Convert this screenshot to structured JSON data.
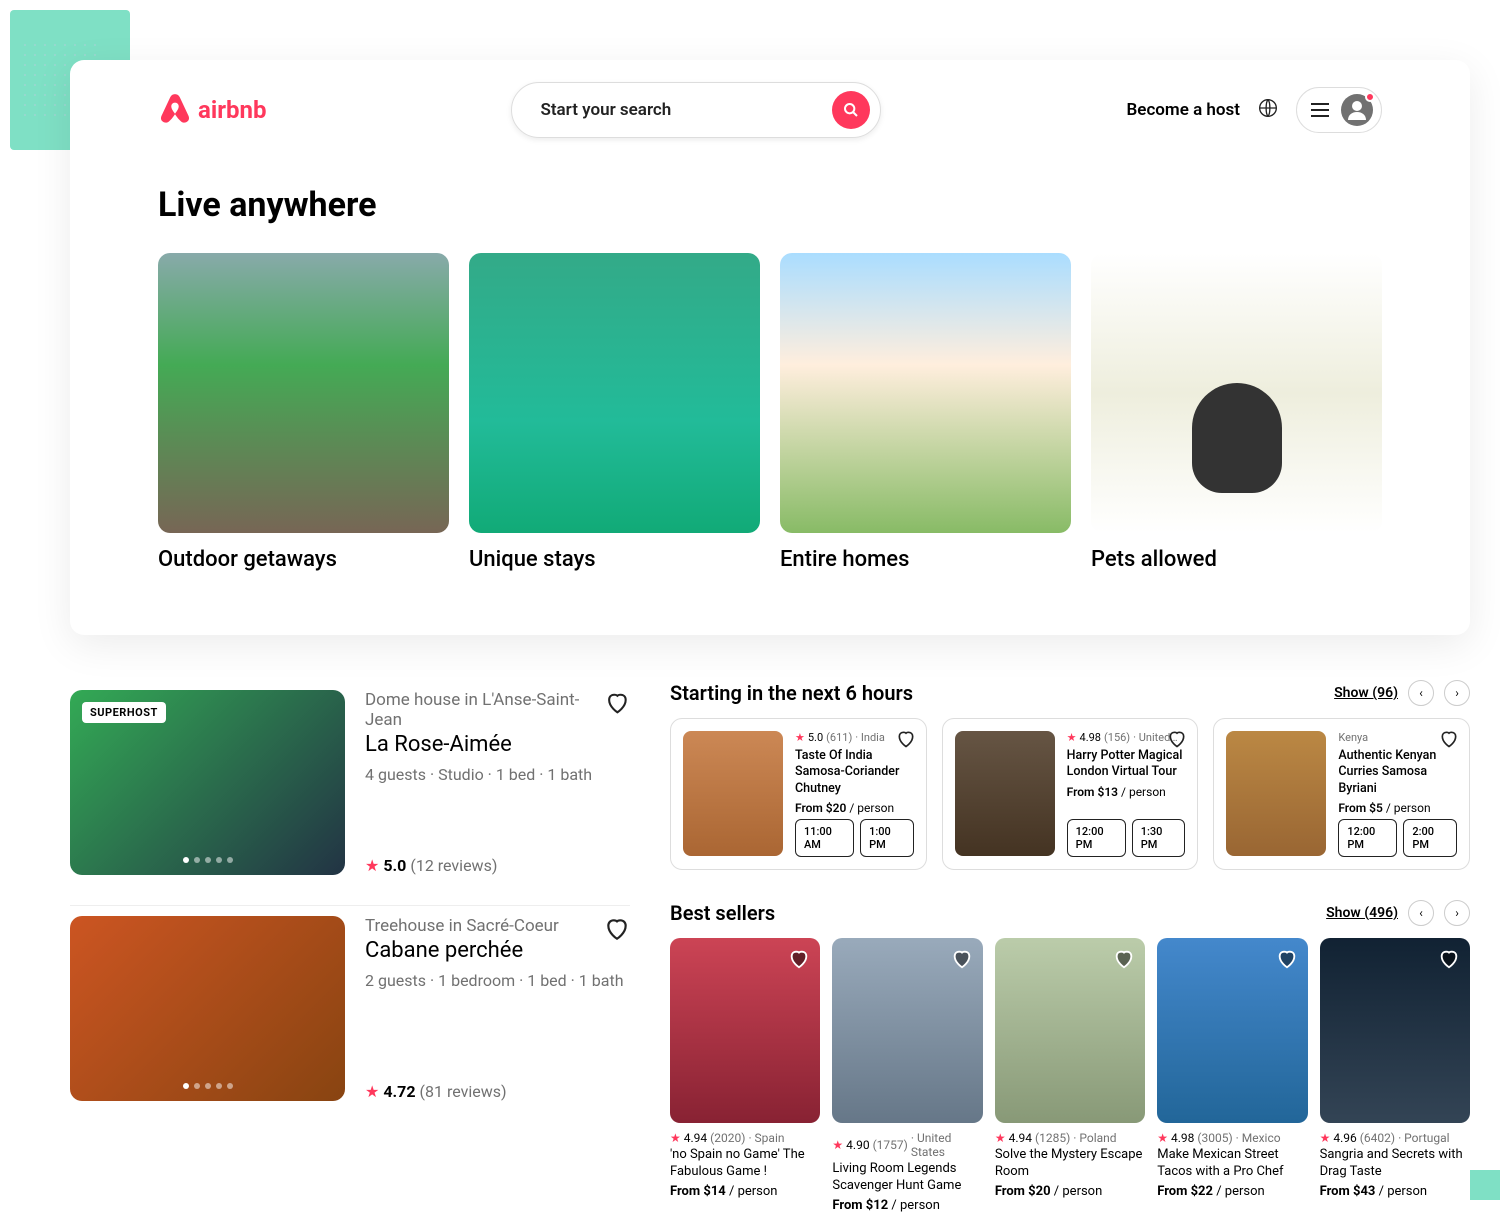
{
  "header": {
    "brand": "airbnb",
    "search_placeholder": "Start your search",
    "host_label": "Become a host"
  },
  "live_anywhere": {
    "title": "Live anywhere",
    "categories": [
      {
        "label": "Outdoor getaways"
      },
      {
        "label": "Unique stays"
      },
      {
        "label": "Entire homes"
      },
      {
        "label": "Pets allowed"
      }
    ]
  },
  "listings": [
    {
      "badge": "SUPERHOST",
      "subtitle": "Dome house in L'Anse-Saint-Jean",
      "title": "La Rose-Aimée",
      "details": "4 guests · Studio · 1 bed · 1 bath",
      "rating": "5.0",
      "reviews": "(12 reviews)"
    },
    {
      "subtitle": "Treehouse in Sacré-Coeur",
      "title": "Cabane perchée",
      "details": "2 guests · 1 bedroom · 1 bed · 1 bath",
      "rating": "4.72",
      "reviews": "(81 reviews)"
    }
  ],
  "starting_soon": {
    "title": "Starting in the next 6 hours",
    "show": "Show (96)",
    "items": [
      {
        "rating": "5.0",
        "count": "(611)",
        "location": "· India",
        "name": "Taste Of India Samosa-Coriander Chutney",
        "price": "From $20",
        "per": " / person",
        "times": [
          "11:00 AM",
          "1:00 PM"
        ]
      },
      {
        "rating": "4.98",
        "count": "(156)",
        "location": "· United…",
        "name": "Harry Potter Magical London Virtual Tour",
        "price": "From $13",
        "per": " / person",
        "times": [
          "12:00 PM",
          "1:30 PM"
        ]
      },
      {
        "location": "Kenya",
        "name": "Authentic Kenyan Curries Samosa Byriani",
        "price": "From $5",
        "per": " / person",
        "times": [
          "12:00 PM",
          "2:00 PM"
        ]
      }
    ]
  },
  "best_sellers": {
    "title": "Best sellers",
    "show": "Show (496)",
    "items": [
      {
        "rating": "4.94",
        "count": "(2020)",
        "location": "· Spain",
        "name": "'no Spain no Game' The Fabulous Game !",
        "price": "From $14",
        "per": " / person"
      },
      {
        "rating": "4.90",
        "count": "(1757)",
        "location": "· United States",
        "name": "Living Room Legends Scavenger Hunt Game",
        "price": "From $12",
        "per": " / person"
      },
      {
        "rating": "4.94",
        "count": "(1285)",
        "location": "· Poland",
        "name": "Solve the Mystery Escape Room",
        "price": "From $20",
        "per": " / person"
      },
      {
        "rating": "4.98",
        "count": "(3005)",
        "location": "· Mexico",
        "name": "Make Mexican Street Tacos with a Pro Chef",
        "price": "From $22",
        "per": " / person"
      },
      {
        "rating": "4.96",
        "count": "(6402)",
        "location": "· Portugal",
        "name": "Sangria and Secrets with Drag Taste",
        "price": "From $43",
        "per": " / person"
      }
    ]
  }
}
